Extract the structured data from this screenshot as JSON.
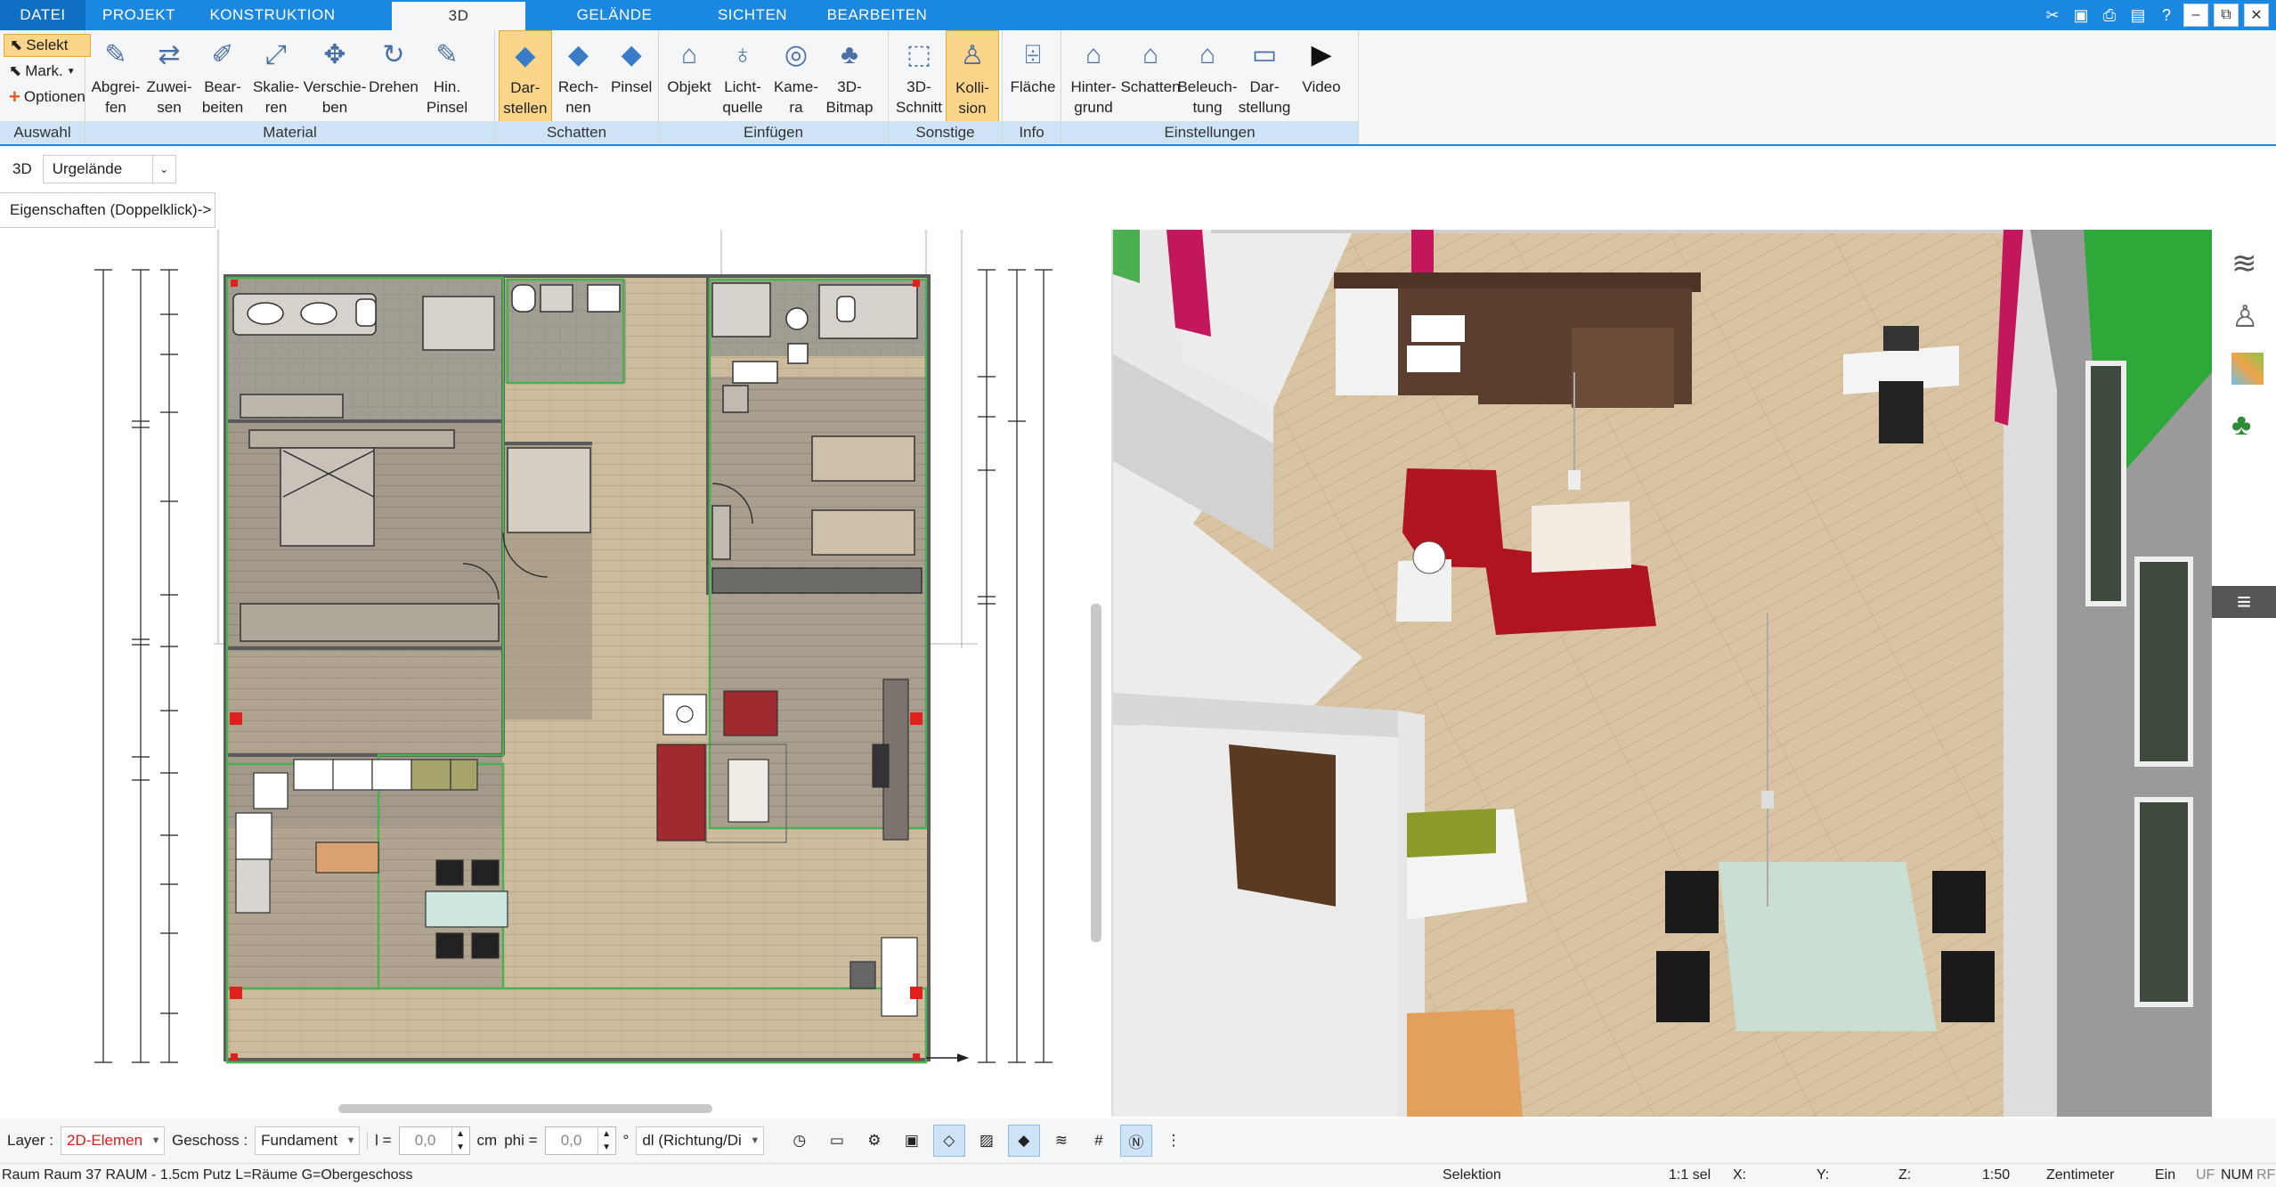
{
  "menu": {
    "tabs": [
      "DATEI",
      "PROJEKT",
      "KONSTRUKTION",
      "3D",
      "GELÄNDE",
      "SICHTEN",
      "BEARBEITEN"
    ],
    "active": "3D"
  },
  "ribbon": {
    "auswahl": {
      "label": "Auswahl",
      "selekt": "Selekt",
      "mark": "Mark.",
      "optionen": "Optionen"
    },
    "material": {
      "label": "Material",
      "buttons": [
        "Abgrei-\nfen",
        "Zuwei-\nsen",
        "Bear-\nbeiten",
        "Skalie-\nren",
        "Verschie-\nben",
        "Drehen",
        "Hin.\nPinsel"
      ]
    },
    "schatten": {
      "label": "Schatten",
      "buttons": [
        "Dar-\nstellen",
        "Rech-\nnen",
        "Pinsel"
      ]
    },
    "einfuegen": {
      "label": "Einfügen",
      "buttons": [
        "Objekt",
        "Licht-\nquelle",
        "Kame-\nra",
        "3D-\nBitmap"
      ]
    },
    "sonstige": {
      "label": "Sonstige",
      "buttons": [
        "3D-\nSchnitt",
        "Kolli-\nsion"
      ]
    },
    "info": {
      "label": "Info",
      "buttons": [
        "Fläche"
      ]
    },
    "einstellungen": {
      "label": "Einstellungen",
      "buttons": [
        "Hinter-\ngrund",
        "Schatten",
        "Beleuch-\ntung",
        "Dar-\nstellung",
        "Video"
      ]
    }
  },
  "viewbar": {
    "mode": "3D",
    "terrain": "Urgelände"
  },
  "properties_hint": "Eigenschaften (Doppelklick)->",
  "bottombar": {
    "layer_label": "Layer :",
    "layer_value": "2D-Elemen",
    "geschoss_label": "Geschoss :",
    "geschoss_value": "Fundament",
    "l_label": "l =",
    "l_value": "0,0",
    "l_unit": "cm",
    "phi_label": "phi =",
    "phi_value": "0,0",
    "phi_unit": "°",
    "dir_value": "dl (Richtung/Di"
  },
  "status": {
    "left": "Raum Raum 37 RAUM - 1.5cm Putz L=Räume G=Obergeschoss",
    "mode": "Selektion",
    "sel": "1:1 sel",
    "x": "X:",
    "y": "Y:",
    "z": "Z:",
    "scale": "1:50",
    "unit": "Zentimeter",
    "ein": "Ein",
    "uf": "UF",
    "num": "NUM",
    "rf": "RF"
  },
  "colors": {
    "accent": "#1a87e0",
    "ribbon_group": "#cfe3f7",
    "active_btn": "#fbd68a",
    "wall": "#4caf50",
    "floor": "#cdb89a"
  }
}
